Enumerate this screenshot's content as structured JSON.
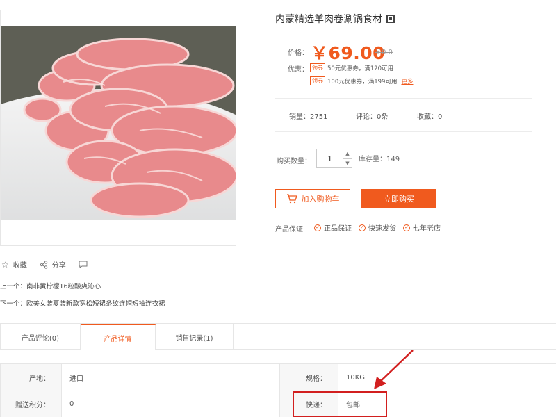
{
  "product": {
    "title": "内蒙精选羊肉卷涮锅食材",
    "price_label": "价格：",
    "price": "￥69.00",
    "orig_price": "￥0.0",
    "coupon_label": "优惠：",
    "coupons": [
      {
        "tag": "领券",
        "text": "50元优惠券，满120可用"
      },
      {
        "tag": "领券",
        "text": "100元优惠券，满199可用"
      }
    ],
    "coupon_more": "更多",
    "sales": "销量：2751",
    "reviews": "评论：0条",
    "favorites": "收藏：0",
    "qty_label": "购买数量：",
    "qty_value": "1",
    "stock": "库存量：149",
    "add_cart": "加入购物车",
    "buy_now": "立即购买",
    "guarantee_label": "产品保证",
    "guarantees": [
      "正品保证",
      "快速发货",
      "七年老店"
    ]
  },
  "actions": {
    "favorite": "收藏",
    "share": "分享"
  },
  "nav": {
    "prev": "上一个：南非黄柠檬16粒酸爽沁心",
    "next": "下一个：欧美女装夏装新款宽松短裙条纹连帽短袖连衣裙"
  },
  "tabs": [
    "产品评论(0)",
    "产品详情",
    "销售记录(1)"
  ],
  "specs": [
    {
      "k": "产地：",
      "v": "进口"
    },
    {
      "k": "规格：",
      "v": "10KG"
    },
    {
      "k": "赠送积分：",
      "v": "0"
    },
    {
      "k": "快递：",
      "v": "包邮"
    }
  ],
  "colors": {
    "accent": "#f05a1e",
    "annotation": "#d21f1f"
  },
  "icons": [
    "qr-code-icon",
    "cart-icon",
    "check-icon",
    "star-icon",
    "share-icon",
    "comment-icon"
  ]
}
